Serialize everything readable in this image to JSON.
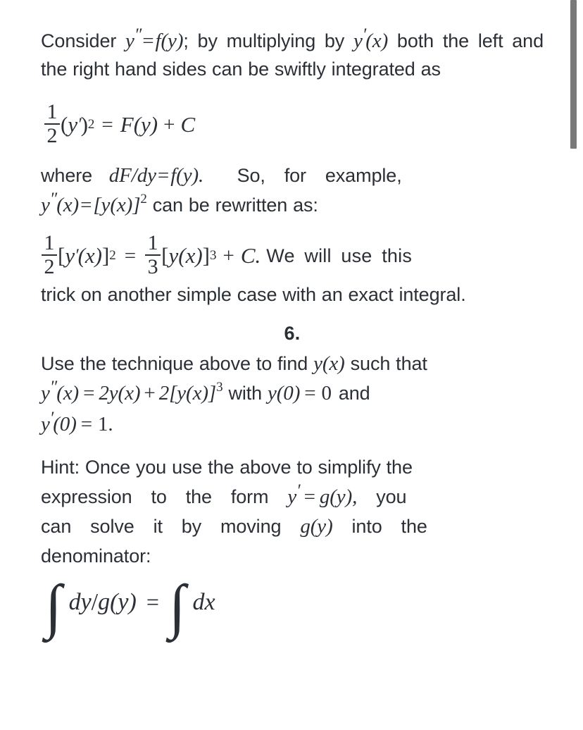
{
  "document": {
    "intro_paragraph": {
      "prefix": "Consider ",
      "eq1_y": "y",
      "eq1_dprime": "″",
      "eq1_eq": "=",
      "eq1_f": "f",
      "eq1_fy": "(y)",
      "mid": "; by multiplying by ",
      "eq2_y": "y",
      "eq2_prime": "′",
      "eq2_x": "(x)",
      "suffix": " both the left and the right hand sides can be swiftly integrated as"
    },
    "equation_1": {
      "frac_num": "1",
      "frac_den": "2",
      "open_paren": "(",
      "y": "y",
      "prime": "′",
      "close_paren": ")",
      "exponent": "2",
      "equals": "=",
      "F": "F",
      "arg": "(y)",
      "plus": "+",
      "C": "C"
    },
    "where_paragraph": {
      "where": "where",
      "dFdy": "dF/dy",
      "equals": "=",
      "fy": "f(y).",
      "so_for_example": "So, for example,",
      "line2_y": "y",
      "line2_dprime": "″",
      "line2_x": "(x)",
      "line2_eq": "=",
      "line2_bracket": "[y(x)]",
      "line2_exp": "2",
      "line2_tail": "can be rewritten as:"
    },
    "equation_2": {
      "lhs_num": "1",
      "lhs_den": "2",
      "lhs_open": "[",
      "lhs_y": "y",
      "lhs_prime": "′",
      "lhs_x": "(x)",
      "lhs_close": "]",
      "lhs_exp": "2",
      "equals": "=",
      "rhs_num": "1",
      "rhs_den": "3",
      "rhs_open": "[",
      "rhs_yx": "y(x)",
      "rhs_close": "]",
      "rhs_exp": "3",
      "plus": "+",
      "C": "C.",
      "tail": "We will use this",
      "continuation": "trick on another simple case with an exact integral."
    },
    "section_number": "6.",
    "problem_statement": {
      "lead": "Use the technique above to find ",
      "yx": "y(x)",
      "lead_tail": " such that",
      "eq_y": "y",
      "eq_dprime": "″",
      "eq_x": "(x)",
      "eq_equals": "=",
      "eq_2y": "2y(x)",
      "eq_plus": "+",
      "eq_2bracket": "2[y(x)]",
      "eq_exp": "3",
      "eq_with": "with ",
      "eq_y0": "y(0)",
      "eq_equals2": "=",
      "eq_zero": "0",
      "eq_and": " and",
      "eq2_y": "y",
      "eq2_prime": "′",
      "eq2_zero_arg": "(0)",
      "eq2_equals": "=",
      "eq2_one": "1."
    },
    "hint_paragraph": {
      "line1": "Hint: Once you use the above to simplify the",
      "line2_pre": "expression to the form ",
      "line2_y": "y",
      "line2_prime": "′",
      "line2_eq": "=",
      "line2_g": "g",
      "line2_gy": "(y),",
      "line2_tail": " you",
      "line3_pre": "can solve it by moving ",
      "line3_g": "g",
      "line3_gy": "(y)",
      "line3_tail": " into the",
      "line4": "denominator:"
    },
    "final_integral": {
      "int1": "∫",
      "dy": "dy",
      "slash": "/",
      "g": "g",
      "gy": "(y)",
      "equals": "=",
      "int2": "∫",
      "dx": "dx"
    }
  },
  "scrollbar": {
    "thumb_color": "#797979",
    "track_color": "#ffffff"
  },
  "theme": {
    "text_color": "#2b2f36",
    "background": "#ffffff"
  }
}
